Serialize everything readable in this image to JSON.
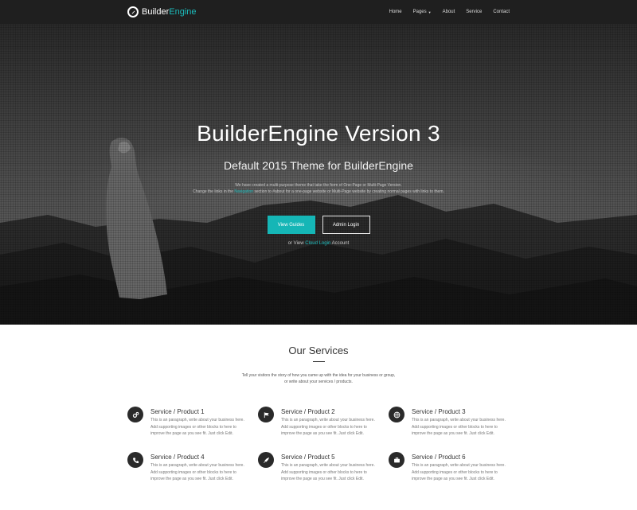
{
  "navbar": {
    "brand_primary": "Builder",
    "brand_accent": "Engine",
    "brand_icon": "compass-icon",
    "accent_color": "#1cbcbc",
    "items": [
      {
        "label": "Home"
      },
      {
        "label": "Pages",
        "has_caret": true
      },
      {
        "label": "About"
      },
      {
        "label": "Service"
      },
      {
        "label": "Contact"
      }
    ]
  },
  "hero": {
    "title": "BuilderEngine Version 3",
    "subtitle": "Default 2015 Theme for BuilderEngine",
    "desc_line1": "We have created a multi-purpose theme that take the form of One-Page or Multi-Page Version.",
    "desc_line2_pre": "Change the links in the",
    "desc_line2_link": "Navigation",
    "desc_line2_post": "section to #about for a one-page website or Multi-Page website by creating normal pages with links to them.",
    "primary_button": "View Guides",
    "secondary_button": "Admin Login",
    "cloud_pre": "or View",
    "cloud_link": "Cloud Login",
    "cloud_post": "Account"
  },
  "services": {
    "title": "Our Services",
    "intro_line1": "Tell your visitors the story of how you came up with the idea for your business or group,",
    "intro_line2": "or write about your services / products.",
    "items": [
      {
        "title": "Service / Product 1",
        "icon": "gears-icon",
        "text": "This is an paragraph, write about your business here. Add supporting images or other blocks to here to improve the page as you see fit. Just click Edit."
      },
      {
        "title": "Service / Product 2",
        "icon": "flag-icon",
        "text": "This is an paragraph, write about your business here. Add supporting images or other blocks to here to improve the page as you see fit. Just click Edit."
      },
      {
        "title": "Service / Product 3",
        "icon": "globe-icon",
        "text": "This is an paragraph, write about your business here. Add supporting images or other blocks to here to improve the page as you see fit. Just click Edit."
      },
      {
        "title": "Service / Product 4",
        "icon": "phone-icon",
        "text": "This is an paragraph, write about your business here. Add supporting images or other blocks to here to improve the page as you see fit. Just click Edit."
      },
      {
        "title": "Service / Product 5",
        "icon": "rocket-icon",
        "text": "This is an paragraph, write about your business here. Add supporting images or other blocks to here to improve the page as you see fit. Just click Edit."
      },
      {
        "title": "Service / Product 6",
        "icon": "briefcase-icon",
        "text": "This is an paragraph, write about your business here. Add supporting images or other blocks to here to improve the page as you see fit. Just click Edit."
      }
    ]
  }
}
